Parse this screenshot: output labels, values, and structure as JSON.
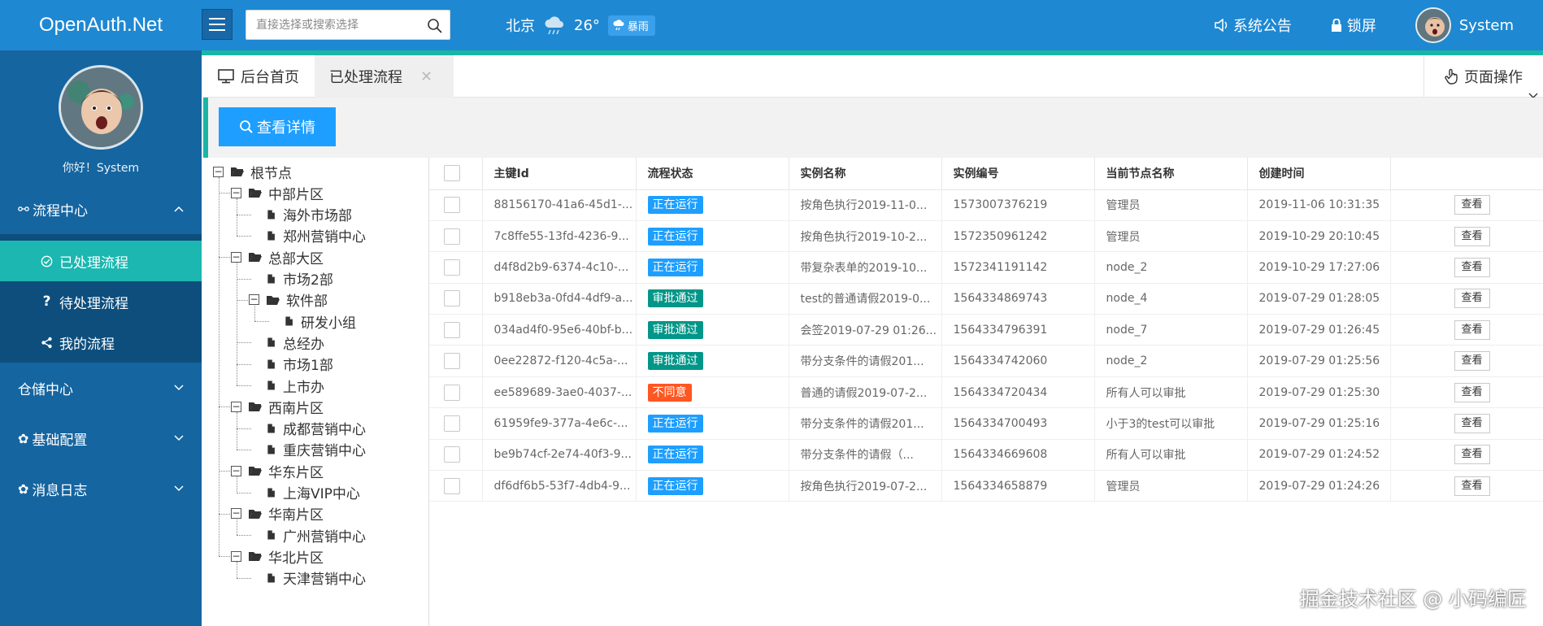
{
  "header": {
    "logo": "OpenAuth.Net",
    "search_placeholder": "直接选择或搜索选择",
    "weather_city": "北京",
    "weather_temp": "26°",
    "weather_badge": "暴雨",
    "notice": "系统公告",
    "lock": "锁屏",
    "user": "System"
  },
  "sidebar": {
    "hello": "你好！System",
    "groups": [
      {
        "label": "流程中心",
        "icon": "flow-icon",
        "expanded": true,
        "items": [
          {
            "label": "已处理流程",
            "icon": "check-circle-icon",
            "active": true
          },
          {
            "label": "待处理流程",
            "icon": "question-icon"
          },
          {
            "label": "我的流程",
            "icon": "share-icon"
          }
        ]
      },
      {
        "label": "仓储中心"
      },
      {
        "label": "基础配置",
        "icon": "gear-icon"
      },
      {
        "label": "消息日志",
        "icon": "gear-icon"
      }
    ]
  },
  "tabs": {
    "home": "后台首页",
    "active": "已处理流程",
    "page_ops": "页面操作"
  },
  "toolbar": {
    "detail_button": "查看详情"
  },
  "tree": [
    {
      "label": "根节点",
      "level": 0,
      "type": "folder"
    },
    {
      "label": "中部片区",
      "level": 1,
      "type": "folder"
    },
    {
      "label": "海外市场部",
      "level": 2,
      "type": "file"
    },
    {
      "label": "郑州营销中心",
      "level": 2,
      "type": "file"
    },
    {
      "label": "总部大区",
      "level": 1,
      "type": "folder"
    },
    {
      "label": "市场2部",
      "level": 2,
      "type": "file"
    },
    {
      "label": "软件部",
      "level": 2,
      "type": "folder"
    },
    {
      "label": "研发小组",
      "level": 3,
      "type": "file"
    },
    {
      "label": "总经办",
      "level": 2,
      "type": "file"
    },
    {
      "label": "市场1部",
      "level": 2,
      "type": "file"
    },
    {
      "label": "上市办",
      "level": 2,
      "type": "file"
    },
    {
      "label": "西南片区",
      "level": 1,
      "type": "folder"
    },
    {
      "label": "成都营销中心",
      "level": 2,
      "type": "file"
    },
    {
      "label": "重庆营销中心",
      "level": 2,
      "type": "file"
    },
    {
      "label": "华东片区",
      "level": 1,
      "type": "folder"
    },
    {
      "label": "上海VIP中心",
      "level": 2,
      "type": "file"
    },
    {
      "label": "华南片区",
      "level": 1,
      "type": "folder"
    },
    {
      "label": "广州营销中心",
      "level": 2,
      "type": "file"
    },
    {
      "label": "华北片区",
      "level": 1,
      "type": "folder"
    },
    {
      "label": "天津营销中心",
      "level": 2,
      "type": "file"
    }
  ],
  "table": {
    "columns": [
      "主键Id",
      "流程状态",
      "实例名称",
      "实例编号",
      "当前节点名称",
      "创建时间"
    ],
    "view_label": "查看",
    "rows": [
      {
        "id": "88156170-41a6-45d1-...",
        "status": "正在运行",
        "status_type": "run",
        "name": "按角色执行2019-11-0...",
        "code": "1573007376219",
        "node": "管理员",
        "time": "2019-11-06 10:31:35"
      },
      {
        "id": "7c8ffe55-13fd-4236-9...",
        "status": "正在运行",
        "status_type": "run",
        "name": "按角色执行2019-10-2...",
        "code": "1572350961242",
        "node": "管理员",
        "time": "2019-10-29 20:10:45"
      },
      {
        "id": "d4f8d2b9-6374-4c10-...",
        "status": "正在运行",
        "status_type": "run",
        "name": "带复杂表单的2019-10...",
        "code": "1572341191142",
        "node": "node_2",
        "time": "2019-10-29 17:27:06"
      },
      {
        "id": "b918eb3a-0fd4-4df9-a...",
        "status": "审批通过",
        "status_type": "ok",
        "name": "test的普通请假2019-0...",
        "code": "1564334869743",
        "node": "node_4",
        "time": "2019-07-29 01:28:05"
      },
      {
        "id": "034ad4f0-95e6-40bf-b...",
        "status": "审批通过",
        "status_type": "ok",
        "name": "会签2019-07-29 01:26...",
        "code": "1564334796391",
        "node": "node_7",
        "time": "2019-07-29 01:26:45"
      },
      {
        "id": "0ee22872-f120-4c5a-...",
        "status": "审批通过",
        "status_type": "ok",
        "name": "带分支条件的请假201...",
        "code": "1564334742060",
        "node": "node_2",
        "time": "2019-07-29 01:25:56"
      },
      {
        "id": "ee589689-3ae0-4037-...",
        "status": "不同意",
        "status_type": "no",
        "name": "普通的请假2019-07-2...",
        "code": "1564334720434",
        "node": "所有人可以审批",
        "time": "2019-07-29 01:25:30"
      },
      {
        "id": "61959fe9-377a-4e6c-...",
        "status": "正在运行",
        "status_type": "run",
        "name": "带分支条件的请假201...",
        "code": "1564334700493",
        "node": "小于3的test可以审批",
        "time": "2019-07-29 01:25:16"
      },
      {
        "id": "be9b74cf-2e74-40f3-9...",
        "status": "正在运行",
        "status_type": "run",
        "name": "带分支条件的请假（...",
        "code": "1564334669608",
        "node": "所有人可以审批",
        "time": "2019-07-29 01:24:52"
      },
      {
        "id": "df6df6b5-53f7-4db4-9...",
        "status": "正在运行",
        "status_type": "run",
        "name": "按角色执行2019-07-2...",
        "code": "1564334658879",
        "node": "管理员",
        "time": "2019-07-29 01:24:26"
      }
    ]
  },
  "watermark": "掘金技术社区 @ 小码编匠"
}
